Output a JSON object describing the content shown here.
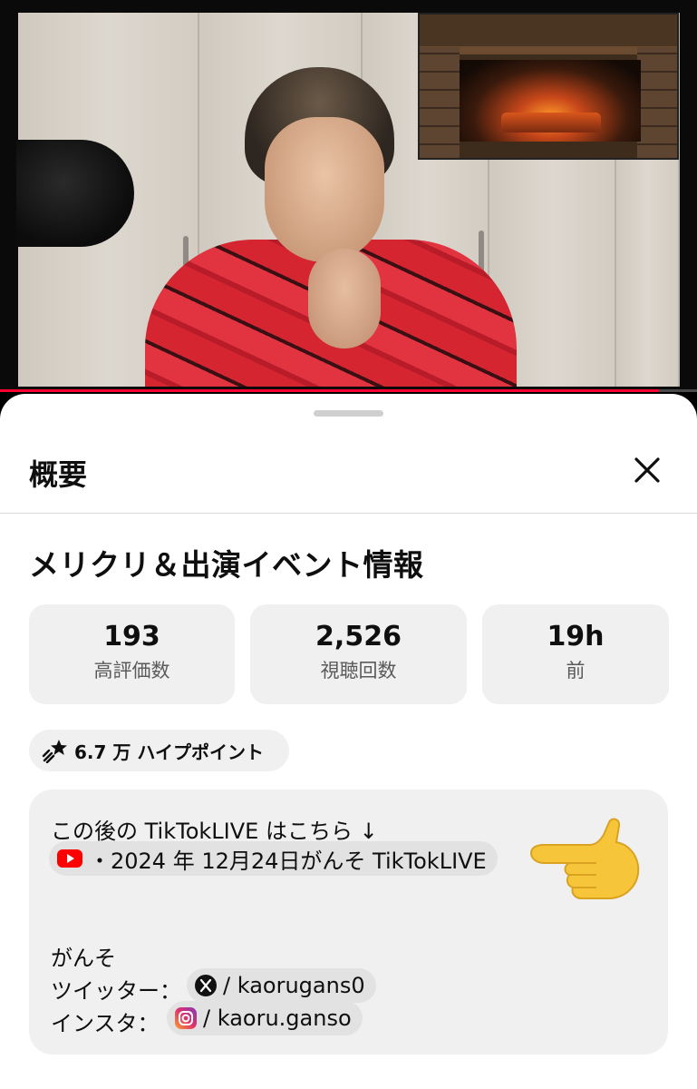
{
  "player": {
    "progress_fraction": 0.945,
    "accent_color": "#ff0033"
  },
  "sheet": {
    "header_title": "概要",
    "close_icon": "close-icon",
    "video_title": "メリクリ＆出演イベント情報"
  },
  "stats": [
    {
      "value": "193",
      "label": "高評価数"
    },
    {
      "value": "2,526",
      "label": "視聴回数"
    },
    {
      "value": "19h",
      "label": "前"
    }
  ],
  "hype": {
    "icon": "hype-icon",
    "label": "6.7 万 ハイプポイント"
  },
  "description": {
    "line1": "この後の TikTokLIVE はこちら ↓",
    "video_link": {
      "icon": "youtube-icon",
      "text": "・2024 年 12月24日がんそ TikTokLIVE"
    },
    "name": "がんそ",
    "twitter_label": "ツイッター：",
    "twitter_link": {
      "icon": "x-icon",
      "text": "/ kaorugans0"
    },
    "insta_label": "インスタ：",
    "insta_link": {
      "icon": "instagram-icon",
      "text": "/ kaoru.ganso"
    },
    "emoji": "pointing-hand-emoji"
  }
}
